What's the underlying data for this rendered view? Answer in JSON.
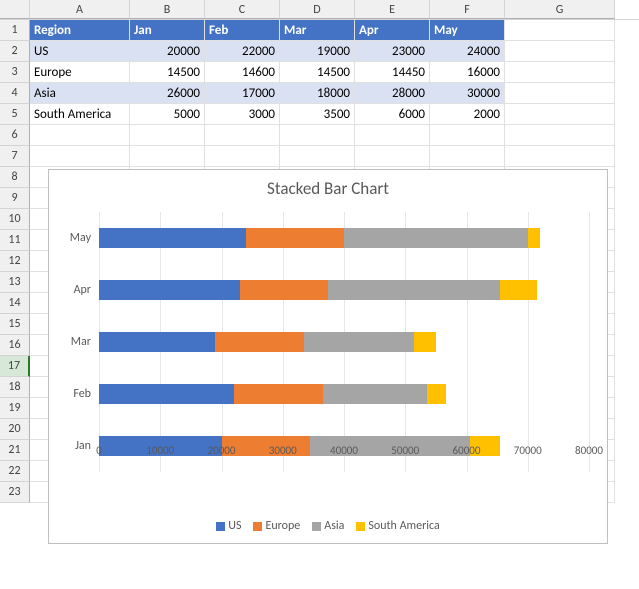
{
  "columns": [
    "A",
    "B",
    "C",
    "D",
    "E",
    "F",
    "G"
  ],
  "col_classes": [
    "cA",
    "cB",
    "cC",
    "cD",
    "cE",
    "cF",
    "cG"
  ],
  "row_ids": [
    "1",
    "2",
    "3",
    "4",
    "5",
    "6",
    "7",
    "8",
    "9",
    "10",
    "11",
    "12",
    "13",
    "14",
    "15",
    "16",
    "17",
    "18",
    "19",
    "20",
    "21",
    "22",
    "23"
  ],
  "table": {
    "headers": [
      "Region",
      "Jan",
      "Feb",
      "Mar",
      "Apr",
      "May"
    ],
    "rows": [
      {
        "region": "US",
        "values": [
          20000,
          22000,
          19000,
          23000,
          24000
        ]
      },
      {
        "region": "Europe",
        "values": [
          14500,
          14600,
          14500,
          14450,
          16000
        ]
      },
      {
        "region": "Asia",
        "values": [
          26000,
          17000,
          18000,
          28000,
          30000
        ]
      },
      {
        "region": "South America",
        "values": [
          5000,
          3000,
          3500,
          6000,
          2000
        ]
      }
    ]
  },
  "chart_data": {
    "type": "bar",
    "orientation": "horizontal",
    "stacked": true,
    "title": "Stacked Bar Chart",
    "categories": [
      "May",
      "Apr",
      "Mar",
      "Feb",
      "Jan"
    ],
    "series": [
      {
        "name": "US",
        "color": "#4472C4",
        "values": [
          24000,
          23000,
          19000,
          22000,
          20000
        ]
      },
      {
        "name": "Europe",
        "color": "#ED7D31",
        "values": [
          16000,
          14450,
          14500,
          14600,
          14500
        ]
      },
      {
        "name": "Asia",
        "color": "#A5A5A5",
        "values": [
          30000,
          28000,
          18000,
          17000,
          26000
        ]
      },
      {
        "name": "South America",
        "color": "#FFC000",
        "values": [
          2000,
          6000,
          3500,
          3000,
          5000
        ]
      }
    ],
    "xlabel": "",
    "ylabel": "",
    "xlim": [
      0,
      80000
    ],
    "x_ticks": [
      0,
      10000,
      20000,
      30000,
      40000,
      50000,
      60000,
      70000,
      80000
    ],
    "legend_position": "bottom"
  },
  "selected_row": "17"
}
